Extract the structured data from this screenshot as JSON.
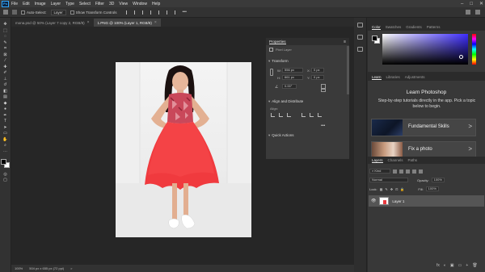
{
  "app": {
    "logo": "Ps",
    "menu": [
      "File",
      "Edit",
      "Image",
      "Layer",
      "Type",
      "Select",
      "Filter",
      "3D",
      "View",
      "Window",
      "Help"
    ],
    "window_controls": [
      "–",
      "□",
      "✕"
    ]
  },
  "options_bar": {
    "auto_select_label": "Auto-Select:",
    "auto_select_value": "Layer",
    "transform_controls_label": "Show Transform Controls"
  },
  "tabs": [
    {
      "label": "mona.psd @ 50% (Layer 7 copy 2, RGB/8)",
      "close": "×"
    },
    {
      "label": "1.PNG @ 100% (Layer 1, RGB/8)",
      "close": "×"
    }
  ],
  "statusbar": {
    "zoom": "100%",
    "doc_size": "504 px x 655 px (72 ppi)",
    "arrow": ">"
  },
  "properties": {
    "title": "Properties",
    "kind_label": "Pixel Layer",
    "transform_title": "Transform",
    "w_label": "W:",
    "w_value": "556 px",
    "h_label": "H:",
    "h_value": "661 px",
    "x_label": "X:",
    "x_value": "0 px",
    "y_label": "Y:",
    "y_value": "0 px",
    "angle_value": "0.00°",
    "align_title": "Align and Distribute",
    "align_sub": "Align:",
    "more": "•••",
    "quick_actions_title": "Quick Actions"
  },
  "color_panel": {
    "tabs": [
      "Color",
      "Swatches",
      "Gradients",
      "Patterns"
    ],
    "fg_color": "#000000",
    "bg_color": "#ffffff"
  },
  "learn_panel": {
    "tabs": [
      "Learn",
      "Libraries",
      "Adjustments"
    ],
    "title": "Learn Photoshop",
    "subtitle": "Step-by-step tutorials directly in the app. Pick a topic below to begin.",
    "cards": [
      {
        "label": "Fundamental Skills",
        "chev": ">"
      },
      {
        "label": "Fix a photo",
        "chev": ">"
      }
    ]
  },
  "layers_panel": {
    "tabs": [
      "Layers",
      "Channels",
      "Paths"
    ],
    "filter_kind": "Kind",
    "blend_mode": "Normal",
    "opacity_label": "Opacity:",
    "opacity_value": "100%",
    "lock_label": "Lock:",
    "fill_label": "Fill:",
    "fill_value": "100%",
    "layer_name": "Layer 1",
    "footer_icons": [
      "fx",
      "◐",
      "▣",
      "▭",
      "+",
      "🗑"
    ]
  },
  "colors": {
    "dress": "#f03a3e",
    "accent": "#31a8ff"
  }
}
